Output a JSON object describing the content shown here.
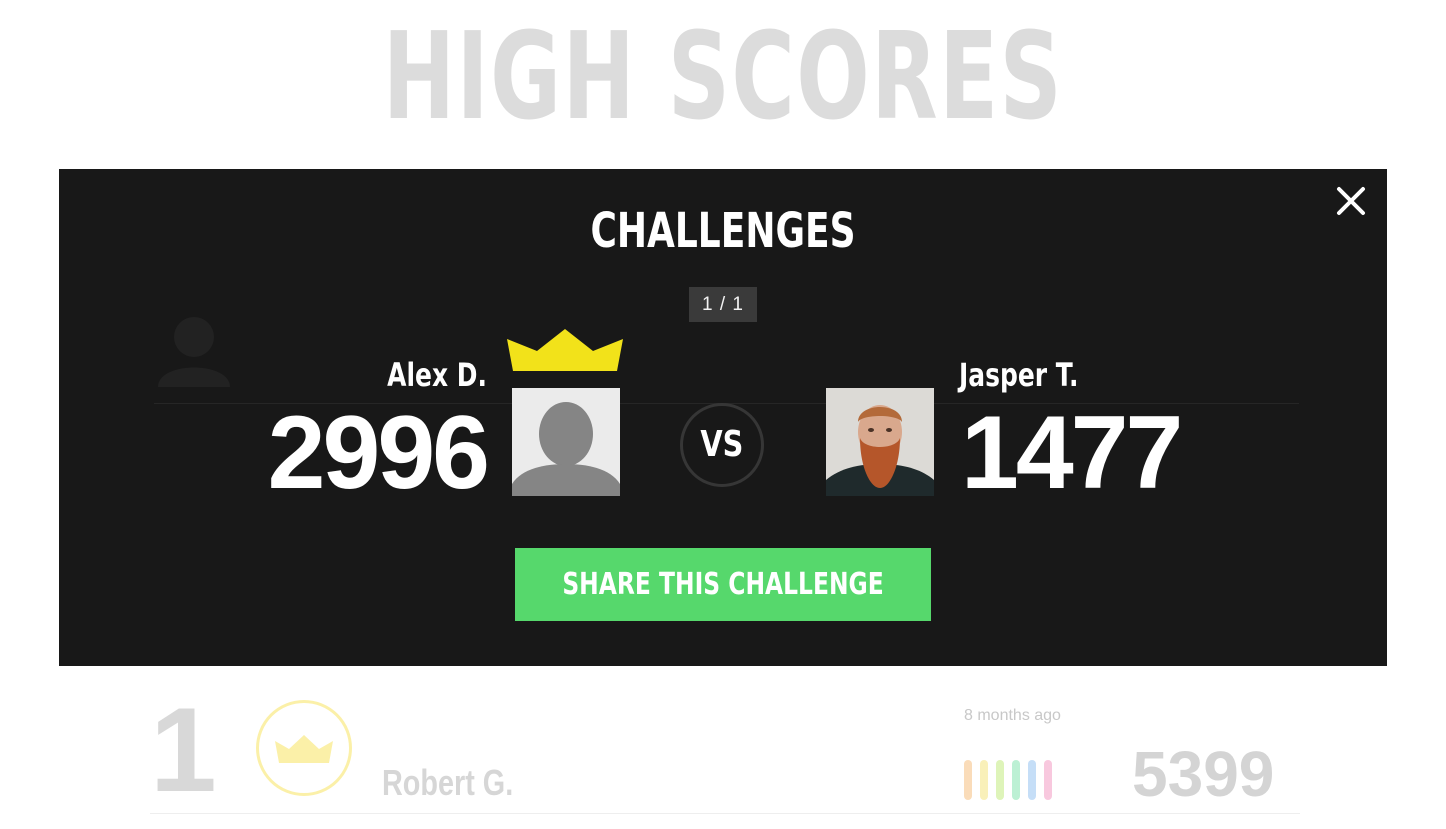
{
  "background": {
    "title": "HIGH SCORES",
    "top_entry": {
      "rank": "1",
      "name": "Robert G.",
      "time_ago": "8 months ago",
      "score": "5399",
      "bar_colors": [
        "#f7c58a",
        "#f5e68a",
        "#c8ec8a",
        "#8fe6b8",
        "#9fc8f2",
        "#f3a3c8"
      ]
    }
  },
  "modal": {
    "title": "CHALLENGES",
    "pager": "1 / 1",
    "player_left": {
      "name": "Alex D.",
      "score": "2996",
      "avatar": "default-avatar-icon",
      "winner": true
    },
    "vs_label": "VS",
    "player_right": {
      "name": "Jasper T.",
      "score": "1477",
      "avatar": "photo"
    },
    "share_label": "SHARE THIS CHALLENGE"
  },
  "colors": {
    "modal_bg": "#181818",
    "share_button": "#56d86c",
    "crown": "#f2e21a"
  }
}
